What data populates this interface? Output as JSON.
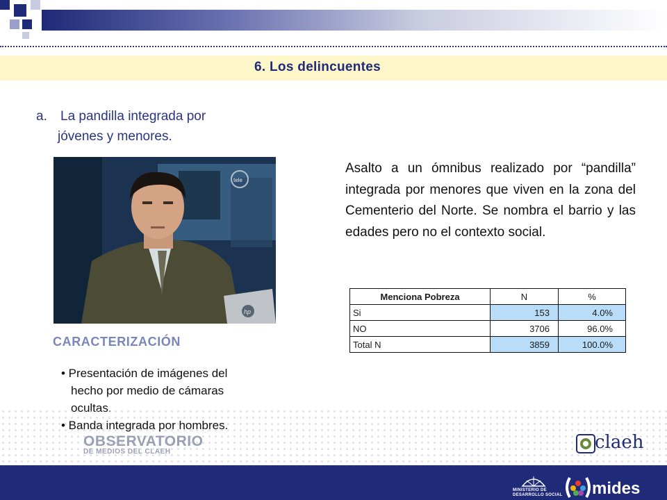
{
  "section": {
    "title": "6.  Los delincuentes"
  },
  "subtitle": {
    "letter": "a.",
    "line1": "La pandilla integrada por",
    "line2": "jóvenes y menores."
  },
  "photo": {
    "channel_logo": "tele",
    "laptop_logo": "hp"
  },
  "description": "Asalto a un ómnibus realizado por “pandilla” integrada por menores que viven en la zona del Cementerio del Norte. Se nombra el barrio y las edades pero no el contexto social.",
  "table": {
    "headers": [
      "Menciona Pobreza",
      "N",
      "%"
    ],
    "rows": [
      {
        "label": "Si",
        "n": "153",
        "pct": "4.0%"
      },
      {
        "label": "NO",
        "n": "3706",
        "pct": "96.0%"
      },
      {
        "label": "Total N",
        "n": "3859",
        "pct": "100.0%"
      }
    ],
    "highlight_color": "#b9dcf8"
  },
  "caracterizacion": {
    "title": "CARACTERIZACIÓN",
    "bullet1_line1": "• Presentación de imágenes del",
    "bullet1_line2": "hecho por medio de cámaras",
    "bullet1_line3": "ocultas.",
    "bullet2": "• Banda integrada por hombres."
  },
  "footer": {
    "observatorio_line1": "OBSERVATORIO",
    "observatorio_line2": "DE MEDIOS DEL CLAEH",
    "claeh": "claeh",
    "ministry_line1": "MINISTERIO DE",
    "ministry_line2": "DESARROLLO SOCIAL",
    "mides": "mides"
  },
  "colors": {
    "navy": "#1f2a78",
    "band": "#fdf6c8",
    "muted_blue": "#7b86b8"
  }
}
